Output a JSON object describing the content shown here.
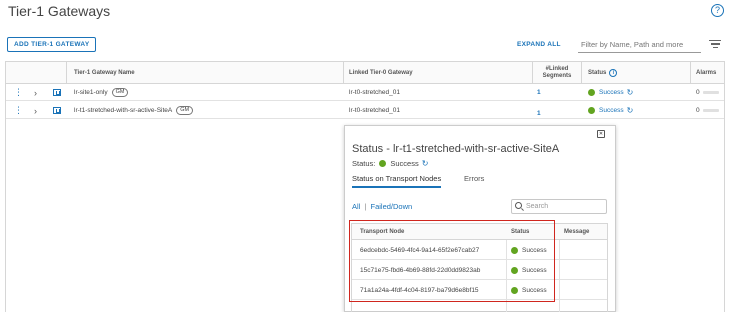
{
  "page": {
    "title": "Tier-1 Gateways"
  },
  "toolbar": {
    "add_button": "ADD TIER-1 GATEWAY",
    "expand_all": "EXPAND ALL",
    "filter_placeholder": "Filter by Name, Path and more"
  },
  "grid": {
    "columns": {
      "name": "Tier-1 Gateway Name",
      "linked_t0": "Linked Tier-0 Gateway",
      "linked_segments": "#Linked Segments",
      "status": "Status",
      "alarms": "Alarms"
    },
    "rows": [
      {
        "name": "lr-site1-only",
        "badge": "GM",
        "linked_t0": "lr-t0-stretched_01",
        "segments": "1",
        "status": "Success",
        "alarms": "0"
      },
      {
        "name": "lr-t1-stretched-with-sr-active-SiteA",
        "badge": "GM",
        "linked_t0": "lr-t0-stretched_01",
        "segments": "1",
        "status": "Success",
        "alarms": "0"
      }
    ]
  },
  "popover": {
    "title": "Status - lr-t1-stretched-with-sr-active-SiteA",
    "status_label": "Status:",
    "status_value": "Success",
    "tabs": [
      "Status on Transport Nodes",
      "Errors"
    ],
    "filter_all": "All",
    "filter_sep": "|",
    "filter_failed": "Failed/Down",
    "search_placeholder": "Search",
    "table": {
      "columns": {
        "node": "Transport Node",
        "status": "Status",
        "message": "Message"
      },
      "rows": [
        {
          "node": "6edcebdc-5469-4fc4-9a14-65f2e67cab27",
          "status": "Success",
          "message": ""
        },
        {
          "node": "15c71e75-fbd6-4b69-88fd-22d0dd9823ab",
          "status": "Success",
          "message": ""
        },
        {
          "node": "71a1a24a-4fdf-4c04-8197-ba79d6e8bf15",
          "status": "Success",
          "message": ""
        }
      ]
    }
  },
  "icons": {
    "help": "help-circle-icon",
    "filter": "filter-lines-icon",
    "row_menu": "vertical-dots-icon",
    "expand": "chevron-right-icon",
    "gateway": "gateway-icon",
    "refresh": "refresh-icon",
    "info": "info-icon",
    "close": "close-icon",
    "search": "search-icon"
  },
  "colors": {
    "accent": "#1a73b8",
    "success": "#62a420",
    "highlight": "#d0261e"
  }
}
